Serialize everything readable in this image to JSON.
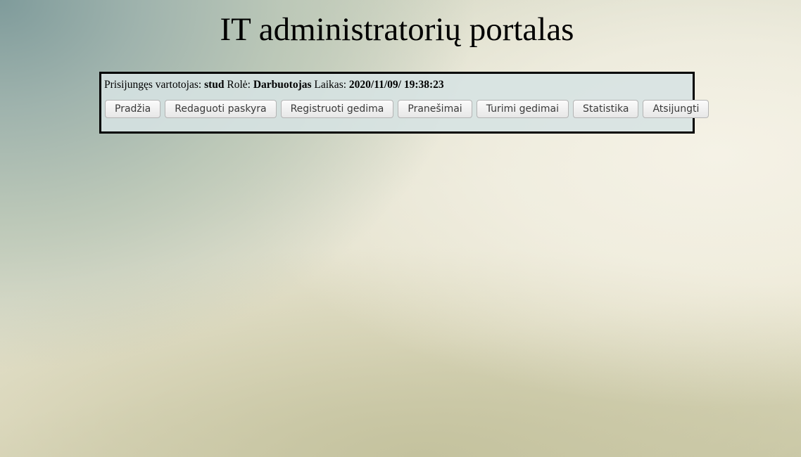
{
  "page": {
    "title": "IT administratorių portalas"
  },
  "user_info": {
    "user_label": "Prisijungęs vartotojas:",
    "user_value": "stud",
    "role_label": "Rolė:",
    "role_value": "Darbuotojas",
    "time_label": "Laikas:",
    "time_value": "2020/11/09/ 19:38:23"
  },
  "nav": {
    "buttons": [
      "Pradžia",
      "Redaguoti paskyra",
      "Registruoti gedima",
      "Pranešimai",
      "Turimi gedimai",
      "Statistika",
      "Atsijungti"
    ]
  }
}
